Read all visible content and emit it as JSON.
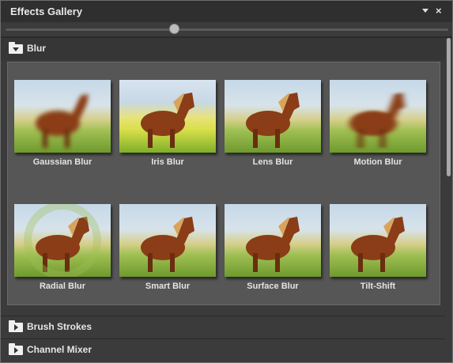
{
  "window": {
    "title": "Effects Gallery",
    "menu_icon": "dropdown-arrow-icon",
    "close_icon": "close-icon",
    "close_glyph": "×"
  },
  "zoom_slider": {
    "value": 0.38
  },
  "categories": [
    {
      "label": "Blur",
      "expanded": true,
      "effects": [
        {
          "label": "Gaussian Blur"
        },
        {
          "label": "Iris Blur"
        },
        {
          "label": "Lens Blur"
        },
        {
          "label": "Motion Blur"
        },
        {
          "label": "Radial Blur"
        },
        {
          "label": "Smart Blur"
        },
        {
          "label": "Surface Blur"
        },
        {
          "label": "Tilt-Shift"
        }
      ]
    },
    {
      "label": "Brush Strokes",
      "expanded": false
    },
    {
      "label": "Channel Mixer",
      "expanded": false
    }
  ],
  "colors": {
    "panel_bg": "#3b3b3b",
    "content_bg": "#565656",
    "text": "#e6e6e6",
    "horse": "#8a3d16"
  }
}
